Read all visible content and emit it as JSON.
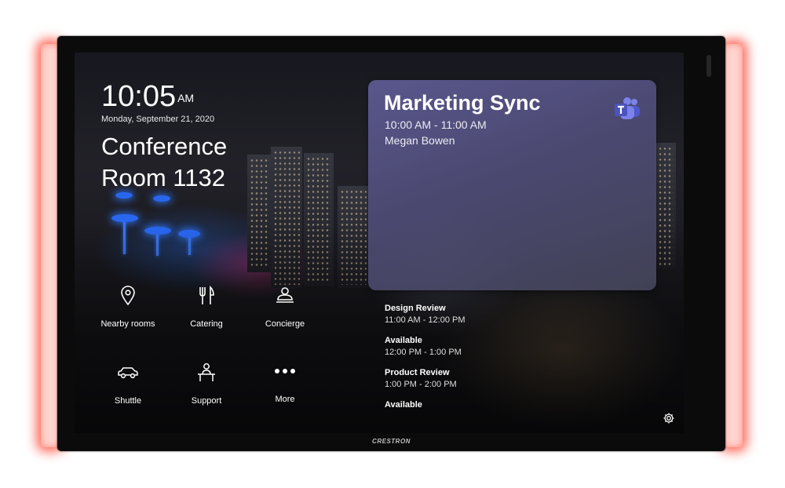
{
  "device": {
    "brand": "CRESTRON",
    "glow_color": "#ff3b2e"
  },
  "header": {
    "time": "10:05",
    "ampm": "AM",
    "date": "Monday, September 21, 2020",
    "room_name": "Conference Room 1132"
  },
  "actions": [
    {
      "label": "Nearby rooms",
      "icon": "location-pin-icon"
    },
    {
      "label": "Catering",
      "icon": "fork-knife-icon"
    },
    {
      "label": "Concierge",
      "icon": "concierge-bell-icon"
    },
    {
      "label": "Shuttle",
      "icon": "car-icon"
    },
    {
      "label": "Support",
      "icon": "person-desk-icon"
    },
    {
      "label": "More",
      "icon": "more-dots-icon"
    }
  ],
  "current_meeting": {
    "title": "Marketing Sync",
    "time": "10:00 AM - 11:00 AM",
    "organizer": "Megan Bowen",
    "platform_icon": "teams-icon",
    "accent": "#5b5fc7"
  },
  "schedule": [
    {
      "title": "Design Review",
      "time": "11:00 AM - 12:00 PM"
    },
    {
      "title": "Available",
      "time": "12:00 PM - 1:00 PM"
    },
    {
      "title": "Product Review",
      "time": "1:00 PM - 2:00 PM"
    },
    {
      "title": "Available",
      "time": ""
    }
  ],
  "footer": {
    "settings_icon": "gear-icon"
  }
}
